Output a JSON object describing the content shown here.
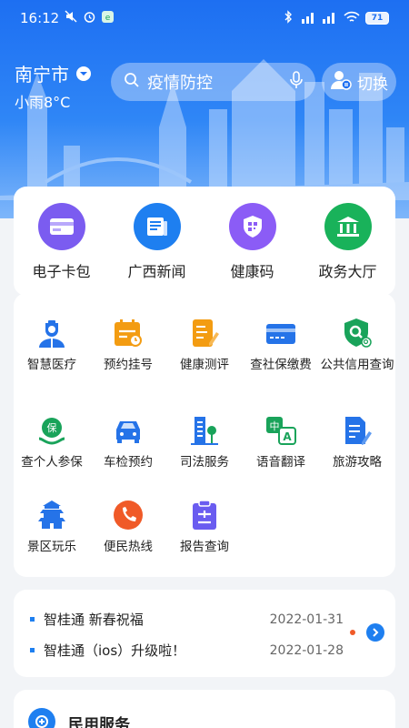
{
  "status_bar": {
    "time": "16:12",
    "battery": "71"
  },
  "header": {
    "city": "南宁市",
    "weather": "小雨8°C",
    "search_placeholder": "疫情防控",
    "switch_label": "切换"
  },
  "quick_actions": [
    {
      "label": "电子卡包",
      "icon": "card-wallet-icon",
      "color": "#7b5cf0"
    },
    {
      "label": "广西新闻",
      "icon": "newspaper-icon",
      "color": "#1e7ff0"
    },
    {
      "label": "健康码",
      "icon": "qr-code-icon",
      "color": "#8b5cf6"
    },
    {
      "label": "政务大厅",
      "icon": "government-hall-icon",
      "color": "#19b25a"
    }
  ],
  "services": [
    {
      "label": "智慧医疗",
      "icon": "doctor-icon",
      "color": "#2573e8"
    },
    {
      "label": "预约挂号",
      "icon": "calendar-icon",
      "color": "#f39c12"
    },
    {
      "label": "健康测评",
      "icon": "health-assessment-icon",
      "color": "#f39c12"
    },
    {
      "label": "查社保缴费",
      "icon": "social-security-card-icon",
      "color": "#2573e8"
    },
    {
      "label": "公共信用查询",
      "icon": "credit-shield-icon",
      "color": "#19a35a"
    },
    {
      "label": "查个人参保",
      "icon": "insurance-icon",
      "color": "#19a35a"
    },
    {
      "label": "车检预约",
      "icon": "car-icon",
      "color": "#2573e8"
    },
    {
      "label": "司法服务",
      "icon": "justice-building-icon",
      "color": "#2573e8"
    },
    {
      "label": "语音翻译",
      "icon": "translate-icon",
      "color": "#19a35a"
    },
    {
      "label": "旅游攻略",
      "icon": "travel-guide-icon",
      "color": "#2573e8"
    },
    {
      "label": "景区玩乐",
      "icon": "pagoda-icon",
      "color": "#2573e8"
    },
    {
      "label": "便民热线",
      "icon": "phone-icon",
      "color": "#f05a28"
    },
    {
      "label": "报告查询",
      "icon": "clipboard-report-icon",
      "color": "#6a5cf0"
    }
  ],
  "news": [
    {
      "title": "智桂通  新春祝福",
      "date": "2022-01-31"
    },
    {
      "title": "智桂通（ios）升级啦！",
      "date": "2022-01-28"
    }
  ],
  "section": {
    "title": "民用服务"
  }
}
